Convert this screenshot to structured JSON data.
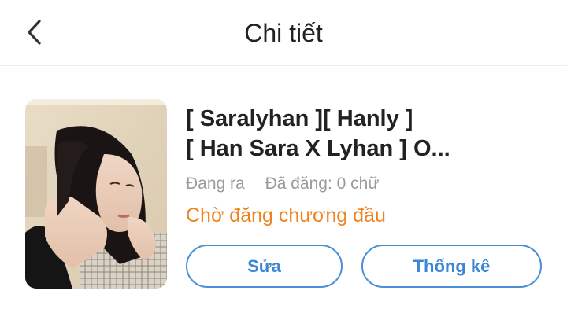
{
  "header": {
    "back_icon": "chevron-left-icon",
    "title": "Chi tiết"
  },
  "story": {
    "cover_icon": "cover-image",
    "title_line1": "[ Saralyhan ][ Hanly ]",
    "title_line2": "[ Han Sara X Lyhan ] O...",
    "state": "Đang ra",
    "posted": "Đã đăng: 0 chữ",
    "status": "Chờ đăng chương đầu"
  },
  "actions": {
    "edit_label": "Sửa",
    "stats_label": "Thống kê"
  },
  "colors": {
    "status_orange": "#f0821e",
    "button_blue": "#3d86d4",
    "text_dark": "#222222",
    "text_muted": "#9a9a9a"
  }
}
